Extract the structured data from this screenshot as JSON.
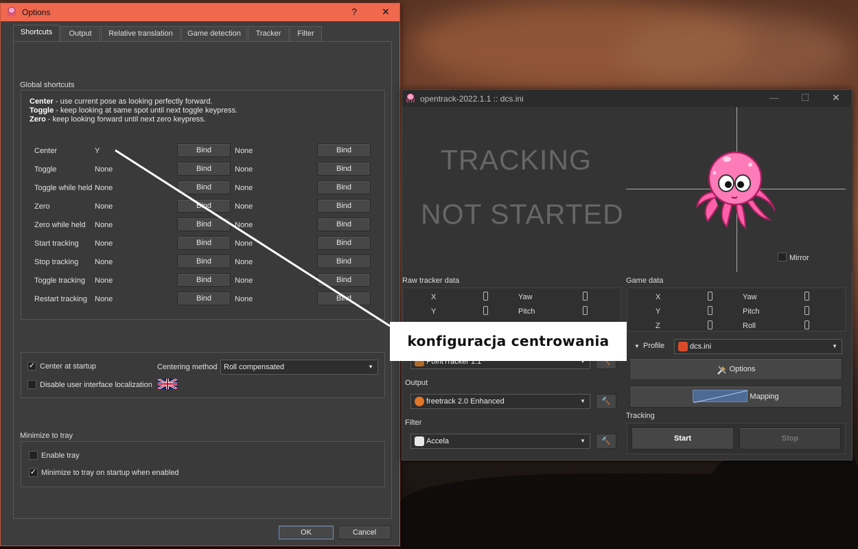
{
  "options": {
    "title": "Options",
    "help_glyph": "?",
    "close_glyph": "✕",
    "tabs": [
      {
        "label": "Shortcuts"
      },
      {
        "label": "Output"
      },
      {
        "label": "Relative translation"
      },
      {
        "label": "Game detection"
      },
      {
        "label": "Tracker"
      },
      {
        "label": "Filter"
      }
    ],
    "global_shortcuts_title": "Global shortcuts",
    "help": {
      "center_bold": "Center",
      "center_text": " - use current pose as looking perfectly forward.",
      "toggle_bold": "Toggle",
      "toggle_text": " - keep looking at same spot until next toggle keypress.",
      "zero_bold": "Zero",
      "zero_text": " - keep looking forward until next zero keypress."
    },
    "bind_label": "Bind",
    "shortcuts": [
      {
        "name": "Center",
        "key1": "Y",
        "key2": "None"
      },
      {
        "name": "Toggle",
        "key1": "None",
        "key2": "None"
      },
      {
        "name": "Toggle while held",
        "key1": "None",
        "key2": "None"
      },
      {
        "name": "Zero",
        "key1": "None",
        "key2": "None"
      },
      {
        "name": "Zero while held",
        "key1": "None",
        "key2": "None"
      },
      {
        "name": "Start tracking",
        "key1": "None",
        "key2": "None"
      },
      {
        "name": "Stop tracking",
        "key1": "None",
        "key2": "None"
      },
      {
        "name": "Toggle tracking",
        "key1": "None",
        "key2": "None"
      },
      {
        "name": "Restart tracking",
        "key1": "None",
        "key2": "None"
      }
    ],
    "center_at_startup": "Center at startup",
    "check_mark": "✓",
    "centering_method_label": "Centering method",
    "centering_method_value": "Roll compensated",
    "disable_localization": "Disable user interface localization",
    "minimize_title": "Minimize to tray",
    "enable_tray": "Enable tray",
    "minimize_on_startup": "Minimize to tray on startup when enabled",
    "ok": "OK",
    "cancel": "Cancel"
  },
  "opentrack": {
    "title": "opentrack-2022.1.1 :: dcs.ini",
    "minimize_glyph": "—",
    "maximize_glyph": "☐",
    "close_glyph": "✕",
    "status_line1": "TRACKING",
    "status_line2": "NOT STARTED",
    "mirror": "Mirror",
    "raw_tracker_title": "Raw tracker data",
    "game_data_title": "Game data",
    "axes_left": [
      "X",
      "Y"
    ],
    "axes_right": [
      "Yaw",
      "Pitch"
    ],
    "game_axes_left": [
      "X",
      "Y",
      "Z"
    ],
    "game_axes_right": [
      "Yaw",
      "Pitch",
      "Roll"
    ],
    "tracker_value": "PointTracker 1.1",
    "output_title": "Output",
    "output_value": "freetrack 2.0 Enhanced",
    "filter_title": "Filter",
    "filter_value": "Accela",
    "profile_label": "Profile",
    "profile_value": "dcs.ini",
    "options_button": "Options",
    "mapping_button": "Mapping",
    "tracking_title": "Tracking",
    "start": "Start",
    "stop": "Stop",
    "tool_glyph": "🔨",
    "combo_arrow": "▼"
  },
  "annotation": {
    "label": "konfiguracja centrowania"
  }
}
